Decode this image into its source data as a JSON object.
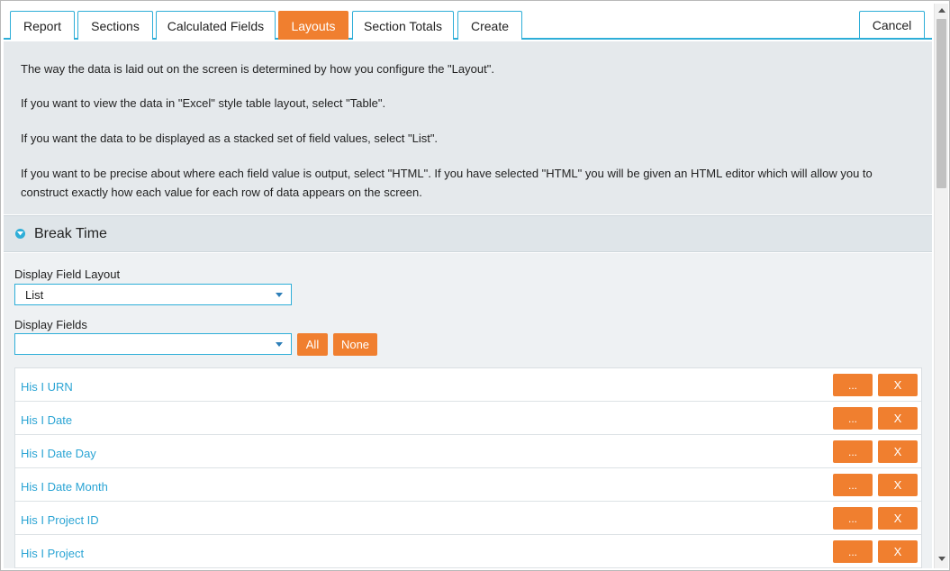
{
  "tabs": [
    {
      "label": "Report"
    },
    {
      "label": "Sections"
    },
    {
      "label": "Calculated Fields"
    },
    {
      "label": "Layouts"
    },
    {
      "label": "Section Totals"
    },
    {
      "label": "Create"
    }
  ],
  "active_tab": "Layouts",
  "cancel_label": "Cancel",
  "info": {
    "line1": "The way the data is laid out on the screen is determined by how you configure the \"Layout\".",
    "line2": "If you want to view the data in \"Excel\" style table layout, select \"Table\".",
    "line3": "If you want the data to be displayed as a stacked set of field values, select \"List\".",
    "line4": "If you want to be precise about where each field value is output, select \"HTML\". If you have selected \"HTML\" you will be given an HTML editor which will allow you to construct exactly how each value for each row of data appears on the screen."
  },
  "section": {
    "title": "Break Time",
    "display_field_layout_label": "Display Field Layout",
    "display_field_layout_value": "List",
    "display_fields_label": "Display Fields",
    "display_fields_value": "",
    "all_label": "All",
    "none_label": "None",
    "fields": [
      {
        "name": "His I URN",
        "more_label": "...",
        "remove_label": "X"
      },
      {
        "name": "His I Date",
        "more_label": "...",
        "remove_label": "X"
      },
      {
        "name": "His I Date Day",
        "more_label": "...",
        "remove_label": "X"
      },
      {
        "name": "His I Date Month",
        "more_label": "...",
        "remove_label": "X"
      },
      {
        "name": "His I Project ID",
        "more_label": "...",
        "remove_label": "X"
      },
      {
        "name": "His I Project",
        "more_label": "...",
        "remove_label": "X"
      }
    ]
  },
  "colors": {
    "accent_blue": "#2eaed8",
    "accent_orange": "#f07f2f",
    "link_blue": "#2aa4d4"
  }
}
